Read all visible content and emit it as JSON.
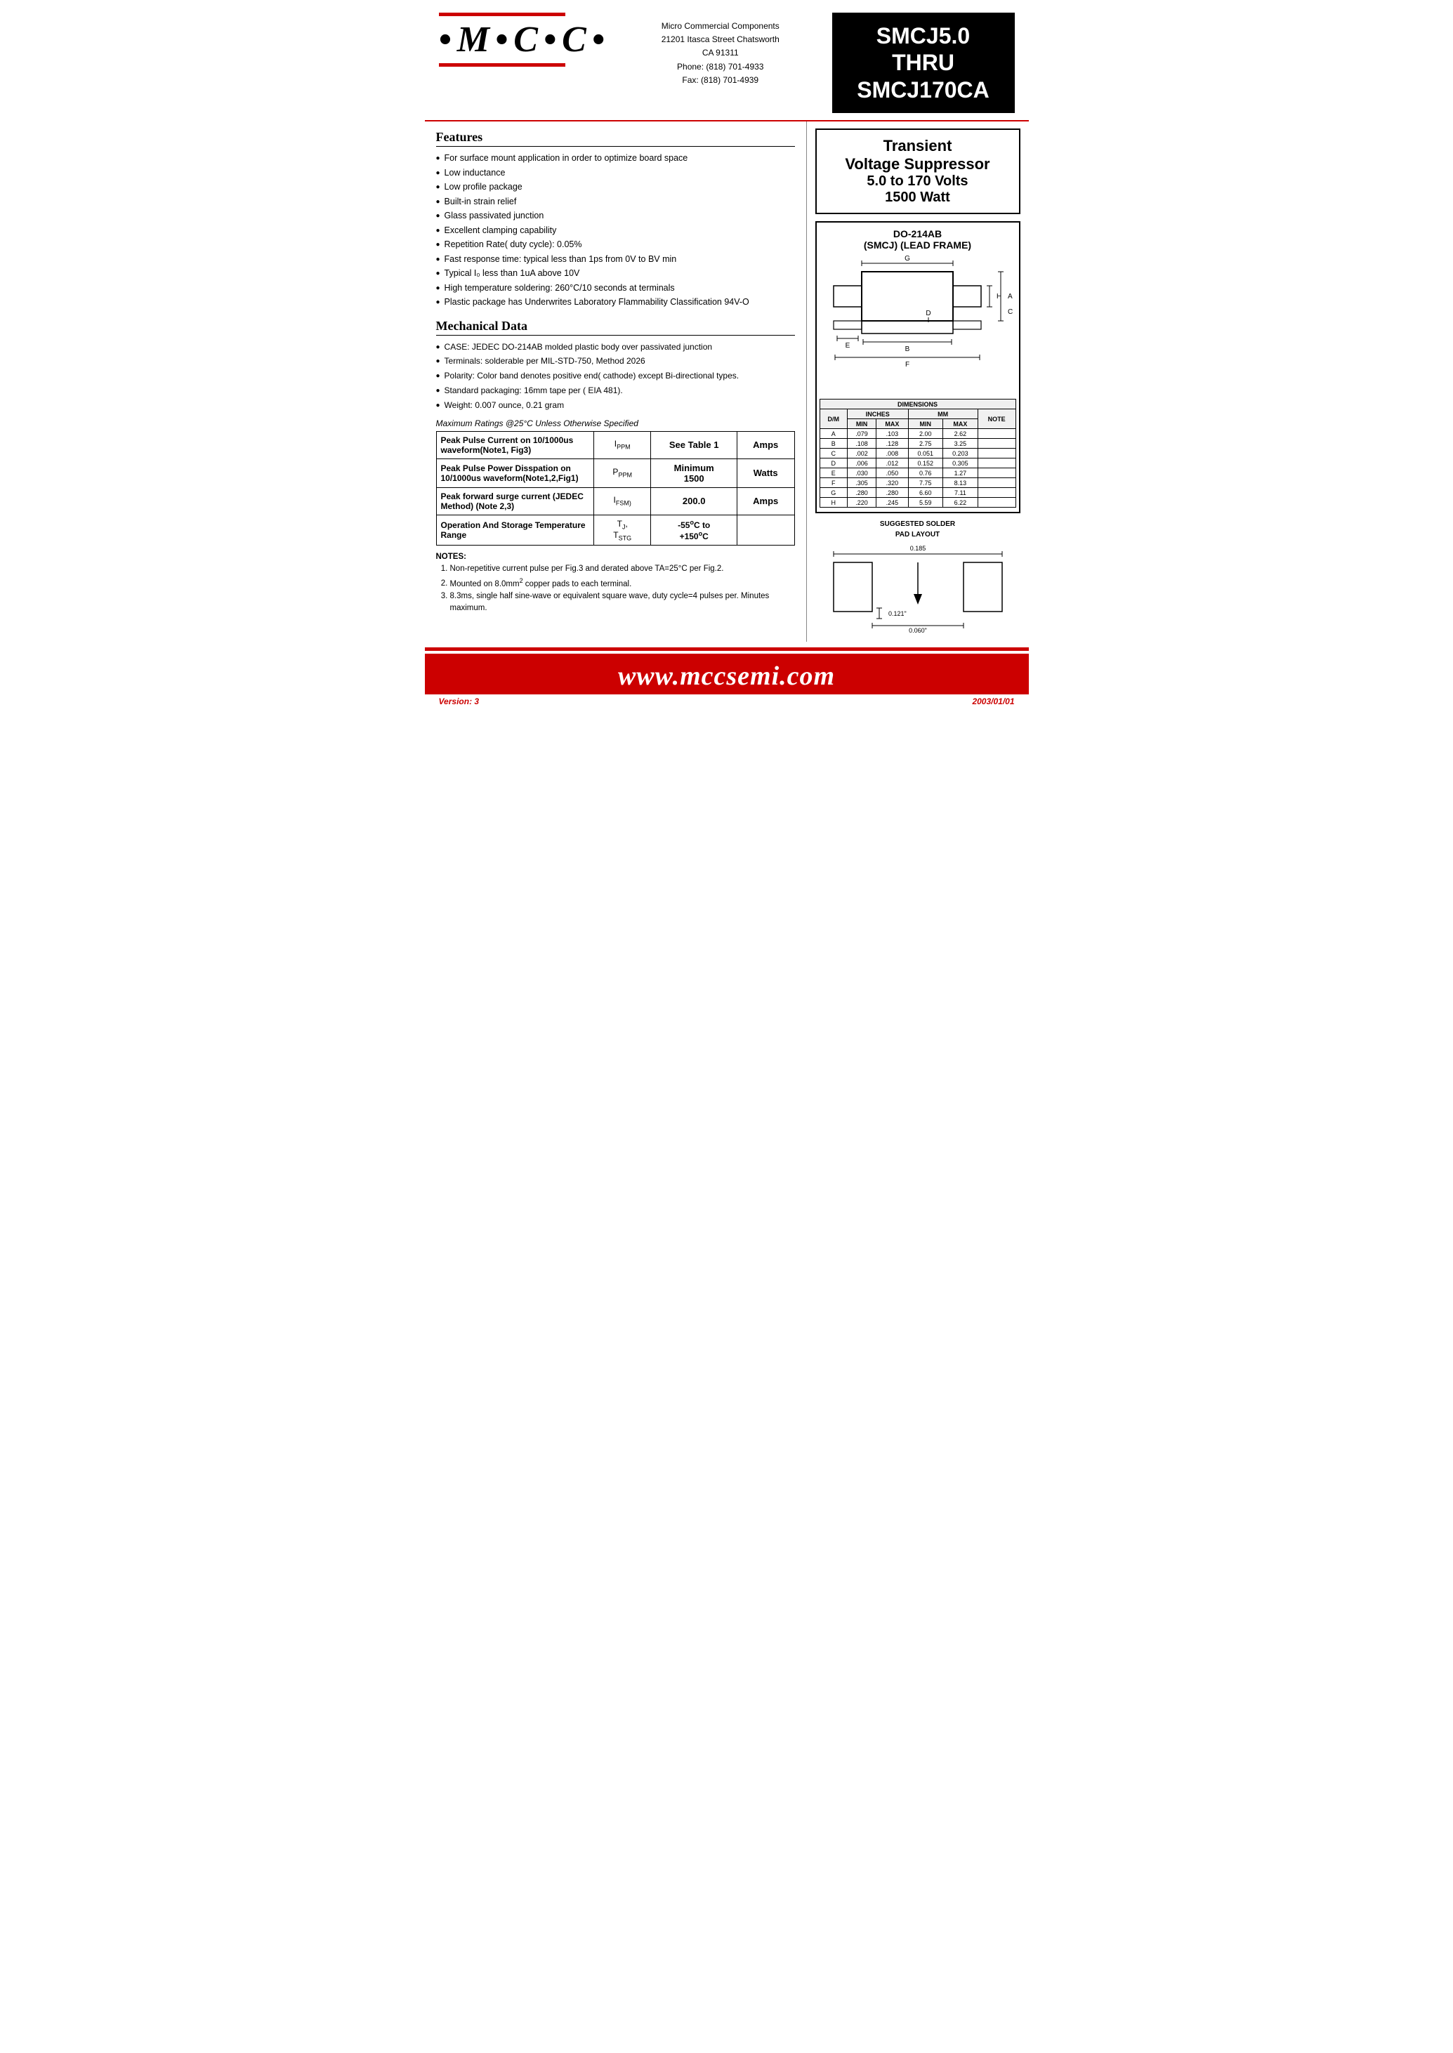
{
  "header": {
    "logo_letters": "M·C·C·",
    "company_name": "Micro Commercial Components",
    "address_line1": "21201 Itasca Street Chatsworth",
    "address_line2": "CA 91311",
    "phone": "Phone:  (818) 701-4933",
    "fax": "Fax:    (818) 701-4939",
    "part_number_line1": "SMCJ5.0",
    "part_number_line2": "THRU",
    "part_number_line3": "SMCJ170CA"
  },
  "tvs": {
    "line1": "Transient",
    "line2": "Voltage Suppressor",
    "line3": "5.0 to 170 Volts",
    "line4": "1500 Watt"
  },
  "package": {
    "title_line1": "DO-214AB",
    "title_line2": "(SMCJ) (LEAD FRAME)"
  },
  "features": {
    "title": "Features",
    "items": [
      "For surface mount application in order to optimize board space",
      "Low inductance",
      "Low profile package",
      "Built-in strain relief",
      "Glass passivated junction",
      "Excellent clamping capability",
      "Repetition Rate( duty cycle): 0.05%",
      "Fast response time: typical less than 1ps from 0V to BV min",
      "Typical I₀ less than 1uA above 10V",
      "High temperature soldering: 260°C/10 seconds at terminals",
      "Plastic package has Underwrites Laboratory Flammability Classification 94V-O"
    ]
  },
  "mechanical": {
    "title": "Mechanical Data",
    "items": [
      "CASE: JEDEC DO-214AB molded plastic body over passivated junction",
      "Terminals:  solderable per MIL-STD-750, Method 2026",
      "Polarity: Color band denotes positive end( cathode) except Bi-directional types.",
      "Standard packaging: 16mm tape per ( EIA 481).",
      "Weight: 0.007 ounce, 0.21 gram"
    ]
  },
  "max_ratings": {
    "note": "Maximum Ratings @25°C Unless Otherwise Specified",
    "rows": [
      {
        "label": "Peak Pulse Current on 10/1000us waveform(Note1, Fig3)",
        "symbol": "Iₚₚₘ",
        "value": "See Table 1",
        "unit": "Amps"
      },
      {
        "label": "Peak Pulse Power Disspation on 10/1000us waveform(Note1,2,Fig1)",
        "symbol": "Pₚₚₘ",
        "value": "Minimum\n1500",
        "unit": "Watts"
      },
      {
        "label": "Peak forward surge current (JEDEC Method) (Note 2,3)",
        "symbol": "Iₜₛₘ₋",
        "value": "200.0",
        "unit": "Amps"
      },
      {
        "label": "Operation And Storage Temperature Range",
        "symbol": "Tⱼ, Tₛₜᴳ",
        "value": "-55°C to +150°C",
        "unit": ""
      }
    ]
  },
  "notes": {
    "title": "NOTES:",
    "items": [
      "Non-repetitive current pulse per Fig.3 and derated above TA=25°C per Fig.2.",
      "Mounted on 8.0mm² copper pads to each terminal.",
      "8.3ms, single half sine-wave or equivalent square wave, duty cycle=4 pulses per. Minutes maximum."
    ]
  },
  "dimensions": {
    "headers_top": [
      "DIMENSIONS"
    ],
    "headers_sub": [
      "INCHES",
      "MM"
    ],
    "col_headers": [
      "D/M",
      "MIN",
      "MAX",
      "MIN",
      "MAX",
      "NOTE"
    ],
    "rows": [
      {
        "dim": "A",
        "in_min": ".079",
        "in_max": ".103",
        "mm_min": "2.00",
        "mm_max": "2.62",
        "note": ""
      },
      {
        "dim": "B",
        "in_min": ".108",
        "in_max": ".128",
        "mm_min": "2.75",
        "mm_max": "3.25",
        "note": ""
      },
      {
        "dim": "C",
        "in_min": ".002",
        "in_max": ".008",
        "mm_min": "0.051",
        "mm_max": "0.203",
        "note": ""
      },
      {
        "dim": "D",
        "in_min": ".006",
        "in_max": ".012",
        "mm_min": "0.152",
        "mm_max": "0.305",
        "note": ""
      },
      {
        "dim": "E",
        "in_min": ".030",
        "in_max": ".050",
        "mm_min": "0.76",
        "mm_max": "1.27",
        "note": ""
      },
      {
        "dim": "F",
        "in_min": ".305",
        "in_max": ".320",
        "mm_min": "7.75",
        "mm_max": "8.13",
        "note": ""
      },
      {
        "dim": "G",
        "in_min": ".280",
        "in_max": ".280",
        "mm_min": "6.60",
        "mm_max": "7.11",
        "note": ""
      },
      {
        "dim": "H",
        "in_min": ".220",
        "in_max": ".245",
        "mm_min": "5.59",
        "mm_max": "6.22",
        "note": ""
      }
    ]
  },
  "solder_pad": {
    "title_line1": "SUGGESTED SOLDER",
    "title_line2": "PAD LAYOUT",
    "dim1": "0.185",
    "dim2": "0.121\"",
    "dim3": "0.060\""
  },
  "footer": {
    "url": "www.mccsemi.com",
    "version_label": "Version:",
    "version_value": "3",
    "date": "2003/01/01"
  }
}
